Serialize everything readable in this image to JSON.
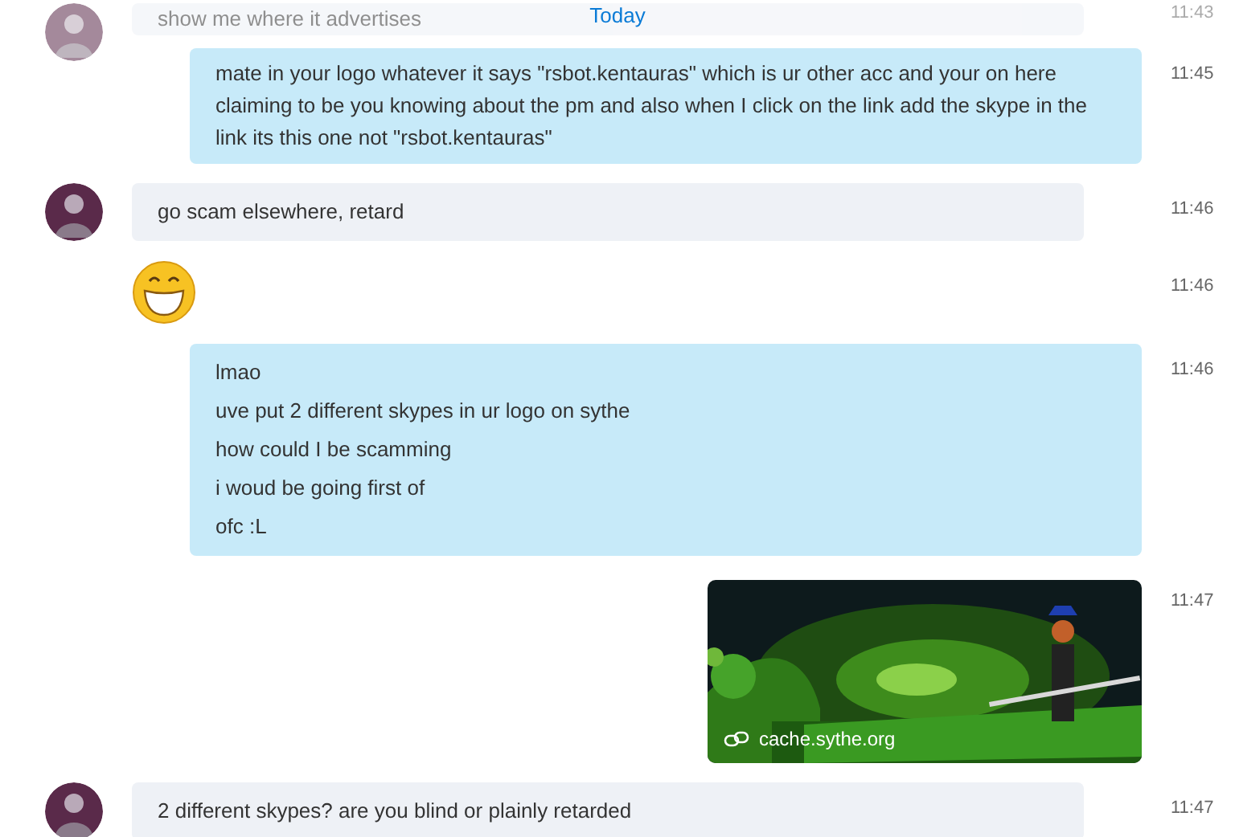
{
  "date_label": "Today",
  "messages": [
    {
      "kind": "incoming",
      "faded": true,
      "lines": [
        "show me where it advertises"
      ],
      "time": "11:43"
    },
    {
      "kind": "outgoing",
      "faded": false,
      "lines": [
        "mate in your logo whatever it says \"rsbot.kentauras\" which is ur other acc and your on here claiming to be you knowing about the pm and also when I click on the link add the skype in the link its this one not \"rsbot.kentauras\""
      ],
      "time": "11:45"
    },
    {
      "kind": "incoming",
      "faded": false,
      "lines": [
        "go scam elsewhere, retard"
      ],
      "time": "11:46"
    },
    {
      "kind": "emoji",
      "faded": false,
      "time": "11:46"
    },
    {
      "kind": "outgoing",
      "faded": false,
      "lines": [
        "lmao",
        "uve put 2 different skypes in ur logo on sythe",
        "how could I be scamming",
        "i woud be going first of",
        "ofc :L"
      ],
      "time": "11:46"
    },
    {
      "faded": false,
      "link": "cache.sythe.org",
      "time": "11:47"
    },
    {
      "kind": "incoming",
      "faded": false,
      "lines": [
        "2 different skypes? are you blind or plainly retarded"
      ],
      "time": "11:47"
    }
  ]
}
